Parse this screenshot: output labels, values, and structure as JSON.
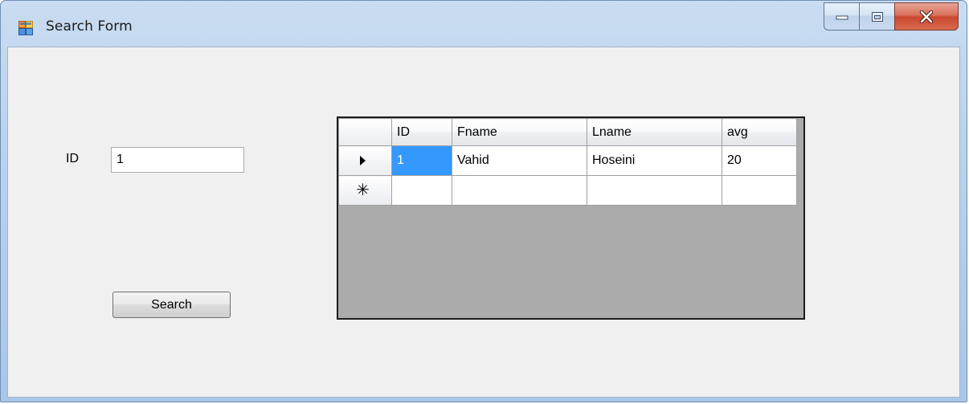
{
  "window": {
    "title": "Search Form",
    "icon": "windows-form-icon",
    "controls": {
      "minimize_icon": "minimize-icon",
      "maximize_icon": "maximize-icon",
      "close_icon": "close-icon"
    }
  },
  "form": {
    "id_label": "ID",
    "id_value": "1",
    "search_button_label": "Search"
  },
  "grid": {
    "columns": [
      "ID",
      "Fname",
      "Lname",
      "avg"
    ],
    "rows": [
      {
        "indicator": "current-row-arrow-icon",
        "cells": [
          "1",
          "Vahid",
          "Hoseini",
          "20"
        ]
      }
    ],
    "new_row_indicator": "new-row-asterisk-icon",
    "new_row_glyph": "✳",
    "selected_cell": {
      "row": 0,
      "column": 0
    },
    "colors": {
      "selection": "#3399ff",
      "empty_area": "#ababab",
      "border": "#1c1c1c"
    }
  }
}
